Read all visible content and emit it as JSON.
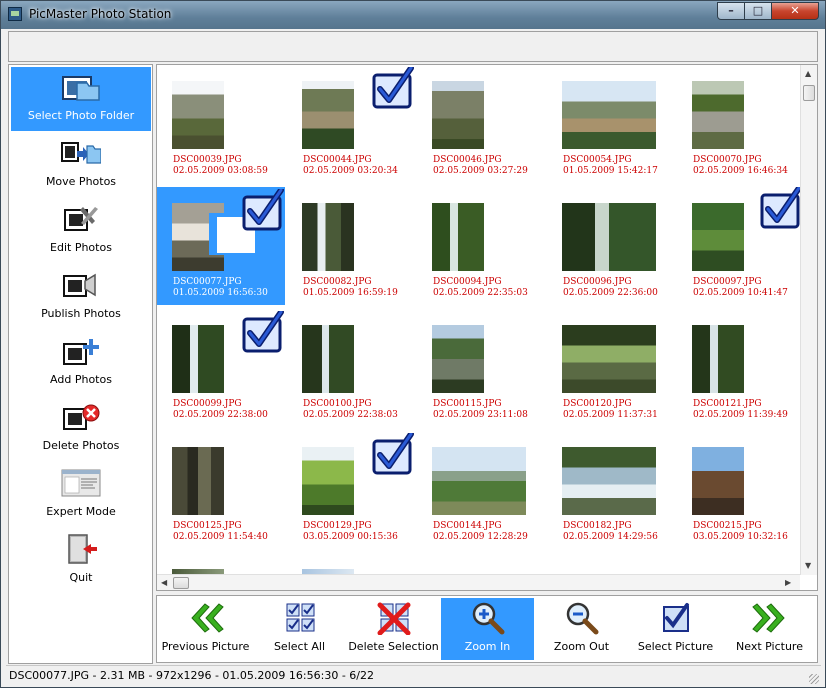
{
  "window": {
    "title": "PicMaster Photo Station",
    "minimize_icon": "minimize-icon",
    "maximize_icon": "maximize-icon",
    "close_icon": "close-icon"
  },
  "sidebar": {
    "items": [
      {
        "label": "Select Photo Folder",
        "icon": "folder-icon",
        "active": true
      },
      {
        "label": "Move Photos",
        "icon": "move-photos-icon",
        "active": false
      },
      {
        "label": "Edit Photos",
        "icon": "edit-photos-icon",
        "active": false
      },
      {
        "label": "Publish Photos",
        "icon": "publish-photos-icon",
        "active": false
      },
      {
        "label": "Add Photos",
        "icon": "add-photos-icon",
        "active": false
      },
      {
        "label": "Delete Photos",
        "icon": "delete-photos-icon",
        "active": false
      },
      {
        "label": "Expert Mode",
        "icon": "expert-mode-icon",
        "active": false
      },
      {
        "label": "Quit",
        "icon": "quit-icon",
        "active": false
      }
    ]
  },
  "gallery": {
    "photos": [
      {
        "name": "DSC00039.JPG",
        "date": "02.05.2009 03:08:59",
        "checked": false,
        "selected": false
      },
      {
        "name": "DSC00044.JPG",
        "date": "02.05.2009 03:20:34",
        "checked": true,
        "selected": false
      },
      {
        "name": "DSC00046.JPG",
        "date": "02.05.2009 03:27:29",
        "checked": false,
        "selected": false
      },
      {
        "name": "DSC00054.JPG",
        "date": "01.05.2009 15:42:17",
        "checked": false,
        "selected": false
      },
      {
        "name": "DSC00070.JPG",
        "date": "02.05.2009 16:46:34",
        "checked": false,
        "selected": false
      },
      {
        "name": "DSC00077.JPG",
        "date": "01.05.2009 16:56:30",
        "checked": true,
        "selected": true
      },
      {
        "name": "DSC00082.JPG",
        "date": "01.05.2009 16:59:19",
        "checked": false,
        "selected": false
      },
      {
        "name": "DSC00094.JPG",
        "date": "02.05.2009 22:35:03",
        "checked": false,
        "selected": false
      },
      {
        "name": "DSC00096.JPG",
        "date": "02.05.2009 22:36:00",
        "checked": false,
        "selected": false
      },
      {
        "name": "DSC00097.JPG",
        "date": "02.05.2009 10:41:47",
        "checked": true,
        "selected": false
      },
      {
        "name": "DSC00099.JPG",
        "date": "02.05.2009 22:38:00",
        "checked": true,
        "selected": false
      },
      {
        "name": "DSC00100.JPG",
        "date": "02.05.2009 22:38:03",
        "checked": false,
        "selected": false
      },
      {
        "name": "DSC00115.JPG",
        "date": "02.05.2009 23:11:08",
        "checked": false,
        "selected": false
      },
      {
        "name": "DSC00120.JPG",
        "date": "02.05.2009 11:37:31",
        "checked": false,
        "selected": false
      },
      {
        "name": "DSC00121.JPG",
        "date": "02.05.2009 11:39:49",
        "checked": false,
        "selected": false
      },
      {
        "name": "DSC00125.JPG",
        "date": "02.05.2009 11:54:40",
        "checked": false,
        "selected": false
      },
      {
        "name": "DSC00129.JPG",
        "date": "03.05.2009 00:15:36",
        "checked": true,
        "selected": false
      },
      {
        "name": "DSC00144.JPG",
        "date": "02.05.2009 12:28:29",
        "checked": false,
        "selected": false
      },
      {
        "name": "DSC00182.JPG",
        "date": "02.05.2009 14:29:56",
        "checked": false,
        "selected": false
      },
      {
        "name": "DSC00215.JPG",
        "date": "03.05.2009 10:32:16",
        "checked": false,
        "selected": false
      }
    ]
  },
  "bottombar": {
    "buttons": [
      {
        "label": "Previous Picture",
        "icon": "previous-picture-icon",
        "active": false
      },
      {
        "label": "Select All",
        "icon": "select-all-icon",
        "active": false
      },
      {
        "label": "Delete Selection",
        "icon": "delete-selection-icon",
        "active": false
      },
      {
        "label": "Zoom In",
        "icon": "zoom-in-icon",
        "active": true
      },
      {
        "label": "Zoom Out",
        "icon": "zoom-out-icon",
        "active": false
      },
      {
        "label": "Select Picture",
        "icon": "select-picture-icon",
        "active": false
      },
      {
        "label": "Next Picture",
        "icon": "next-picture-icon",
        "active": false
      }
    ]
  },
  "status": {
    "text": "DSC00077.JPG - 2.31 MB - 972x1296 - 01.05.2009 16:56:30 - 6/22"
  },
  "colors": {
    "selection": "#3399ff",
    "filename_text": "#cc0000",
    "checkmark": "#1a2f8a"
  }
}
